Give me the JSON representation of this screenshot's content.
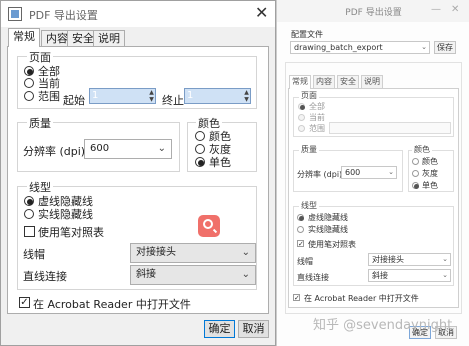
{
  "left": {
    "title": "PDF 导出设置",
    "close_glyph": "✕",
    "tabs": [
      {
        "label": "常规",
        "active": true
      },
      {
        "label": "内容",
        "active": false
      },
      {
        "label": "安全",
        "active": false
      },
      {
        "label": "说明",
        "active": false
      }
    ],
    "pages": {
      "label": "页面",
      "all": "全部",
      "current": "当前",
      "range": "范围",
      "start_label": "起始",
      "start_value": "1",
      "end_label": "终止",
      "end_value": "1",
      "selected": "all"
    },
    "quality": {
      "label": "质量",
      "resolution_label": "分辨率 (dpi)",
      "resolution_value": "600"
    },
    "color": {
      "label": "颜色",
      "options": [
        "颜色",
        "灰度",
        "单色"
      ],
      "selected": "单色"
    },
    "linetype": {
      "label": "线型",
      "dashed_hidden": "虚线隐藏线",
      "solid_hidden": "实线隐藏线",
      "selected": "dashed_hidden",
      "use_pen_table": "使用笔对照表",
      "use_pen_table_checked": false,
      "line_end_label": "线帽",
      "line_end_value": "对接接头",
      "line_join_label": "直线连接",
      "line_join_value": "斜接"
    },
    "open_in_reader": "在 Acrobat Reader 中打开文件",
    "open_in_reader_checked": true,
    "ok": "确定",
    "cancel": "取消"
  },
  "right": {
    "title": "PDF 导出设置",
    "config_label": "配置文件",
    "config_value": "drawing_batch_export",
    "save": "保存",
    "tabs": [
      {
        "label": "常规",
        "active": true
      },
      {
        "label": "内容",
        "active": false
      },
      {
        "label": "安全",
        "active": false
      },
      {
        "label": "说明",
        "active": false
      }
    ],
    "pages": {
      "label": "页面",
      "all": "全部",
      "current": "当前",
      "range": "范围"
    },
    "quality": {
      "label": "质量",
      "resolution_label": "分辨率 (dpi)",
      "resolution_value": "600"
    },
    "color": {
      "label": "颜色",
      "options": [
        "颜色",
        "灰度",
        "单色"
      ],
      "selected": "单色"
    },
    "linetype": {
      "label": "线型",
      "dashed_hidden": "虚线隐藏线",
      "solid_hidden": "实线隐藏线",
      "use_pen_table": "使用笔对照表",
      "line_end_label": "线帽",
      "line_end_value": "对接接头",
      "line_join_label": "直线连接",
      "line_join_value": "斜接"
    },
    "open_in_reader": "在 Acrobat Reader 中打开文件",
    "ok": "确定",
    "cancel": "取消"
  },
  "watermark": "知乎 @sevendaynight",
  "icons": {
    "check": "✓",
    "caret": "⌄",
    "radio_on": "●"
  },
  "colors": {
    "left_bg": "#f0f0f0",
    "selection_blue": "#cfe1f5",
    "badge_red": "#f0706a",
    "primary_border": "#0078d7"
  }
}
